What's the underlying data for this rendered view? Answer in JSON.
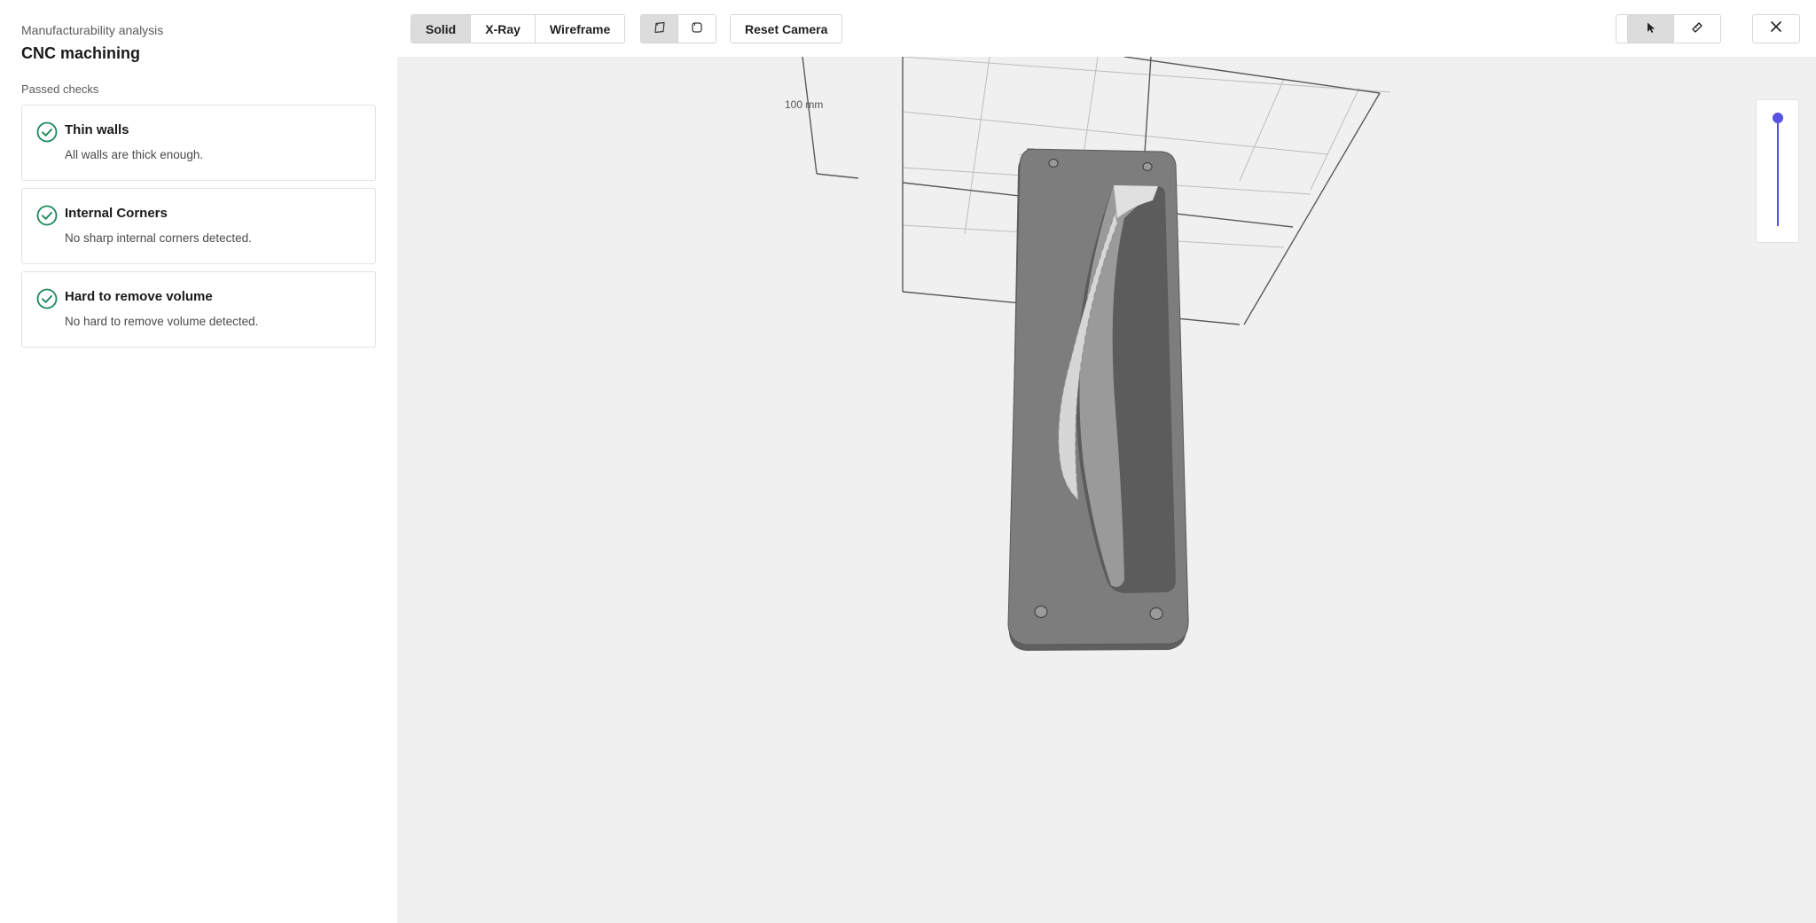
{
  "sidebar": {
    "subtitle": "Manufacturability analysis",
    "title": "CNC machining",
    "section_label": "Passed checks",
    "checks": [
      {
        "title": "Thin walls",
        "description": "All walls are thick enough.",
        "status": "passed"
      },
      {
        "title": "Internal Corners",
        "description": "No sharp internal corners detected.",
        "status": "passed"
      },
      {
        "title": "Hard to remove volume",
        "description": "No hard to remove volume detected.",
        "status": "passed"
      }
    ]
  },
  "toolbar": {
    "view_modes": [
      {
        "label": "Solid",
        "active": true
      },
      {
        "label": "X-Ray",
        "active": false
      },
      {
        "label": "Wireframe",
        "active": false
      }
    ],
    "shading_buttons": [
      {
        "icon": "perspective-cube-icon",
        "active": true
      },
      {
        "icon": "orthographic-cube-icon",
        "active": false
      }
    ],
    "reset_camera_label": "Reset Camera",
    "light_icon": "light-effect-icon",
    "tool_buttons": [
      {
        "icon": "cursor-select-icon",
        "active": true
      },
      {
        "icon": "ruler-measure-icon",
        "active": false
      }
    ],
    "close_icon": "close-icon"
  },
  "viewport": {
    "scale_label": "100 mm",
    "slider_value": 1.0
  },
  "colors": {
    "accent": "#5552e4",
    "check_green": "#1a8a5a",
    "viewport_bg": "#f0f0f0",
    "part_gray": "#7c7c7c"
  }
}
